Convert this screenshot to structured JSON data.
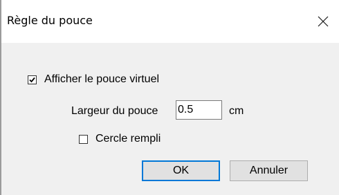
{
  "window": {
    "title": "Règle du pouce",
    "close_glyph": "close-icon"
  },
  "options": {
    "show_virtual_thumb": {
      "label": "Afficher le pouce virtuel",
      "checked": true
    },
    "thumb_width": {
      "label": "Largeur du pouce",
      "value": "0.5",
      "unit": "cm"
    },
    "filled_circle": {
      "label": "Cercle rempli",
      "checked": false
    }
  },
  "buttons": {
    "ok_label": "OK",
    "cancel_label": "Annuler"
  },
  "colors": {
    "accent": "#0078d7",
    "client_bg": "#f0f0f0",
    "button_bg": "#e1e1e1"
  }
}
